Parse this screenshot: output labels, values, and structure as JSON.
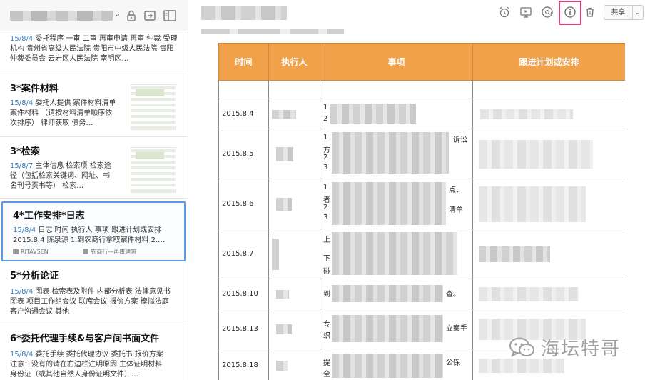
{
  "sidebar": {
    "toolbar": {
      "caret": "⌄",
      "icons": [
        "lock-icon",
        "import-icon",
        "layout-toggle-icon"
      ]
    },
    "notes": [
      {
        "title": "",
        "date": "15/8/4",
        "snippet": "委托程序 一审 二审 再审申请 再审 仲裁 受理机构 贵州省高级人民法院 贵阳市中级人民法院 贵阳仲裁委员会 云岩区人民法院 南明区…"
      },
      {
        "title": "3*案件材料",
        "date": "15/8/4",
        "snippet": "委托人提供 案件材料清单 案件材料 （请按材料清单顺序依次排序） 律师获取 债务…"
      },
      {
        "title": "3*检索",
        "date": "15/8/7",
        "snippet": "主体信息 检索项 检索途径（包括检索关键词、网址、书名刊号页书等） 检索…"
      },
      {
        "title": "4*工作安排*日志",
        "date": "15/8/4",
        "snippet": "日志 时间 执行人 事项 跟进计划或安排 2015.8.4 陈泉源 1.到农商行拿取案件材料 2.…",
        "meta_left": "RITAVSEN",
        "meta_right": "农商行—再审建筑"
      },
      {
        "title": "5*分析论证",
        "date": "15/8/4",
        "snippet": "图表 检索表及附件 内部分析表 法律意见书 图表 项目工作组会议 联席会议 报价方案 模拟法庭 客户沟通会议 其他"
      },
      {
        "title": "6*委托代理手续&与客户间书面文件",
        "date": "15/8/4",
        "snippet": "委托手续 委托代理协议 委托书 报价方案 注意：没有的请在右边栏注明原因 主体证明材料 身份证（或其他自然人身份证明文件）…"
      }
    ]
  },
  "editor": {
    "toolbar": {
      "icons": [
        "alarm-clock-icon",
        "present-icon",
        "mention-icon",
        "info-icon",
        "trash-icon"
      ],
      "highlight_color": "#e23c7b",
      "share_label": "共享",
      "share_caret": "⌄"
    },
    "table": {
      "header_color": "#f0a14a",
      "headers": [
        "时间",
        "执行人",
        "事项",
        "跟进计划或安排"
      ],
      "rows": [
        {
          "date": ""
        },
        {
          "date": "2015.8.4",
          "frag": [
            "1",
            "2"
          ]
        },
        {
          "date": "2015.8.5",
          "frag": [
            "1",
            "方",
            "2",
            "3",
            "诉讼"
          ]
        },
        {
          "date": "2015.8.6",
          "frag": [
            "1",
            "者",
            "2",
            "3",
            "点、",
            "清单"
          ]
        },
        {
          "date": "2015.8.7",
          "frag": [
            "上",
            "下",
            "碰"
          ]
        },
        {
          "date": "2015.8.10",
          "frag": [
            "到",
            "查。"
          ]
        },
        {
          "date": "2015.8.13",
          "frag": [
            "专",
            "织",
            "立案手"
          ]
        },
        {
          "date": "2015.8.18",
          "frag": [
            "提",
            "全",
            "公保"
          ]
        }
      ]
    }
  },
  "watermark": {
    "text": "海坛特哥",
    "icon": "wechat-icon"
  }
}
